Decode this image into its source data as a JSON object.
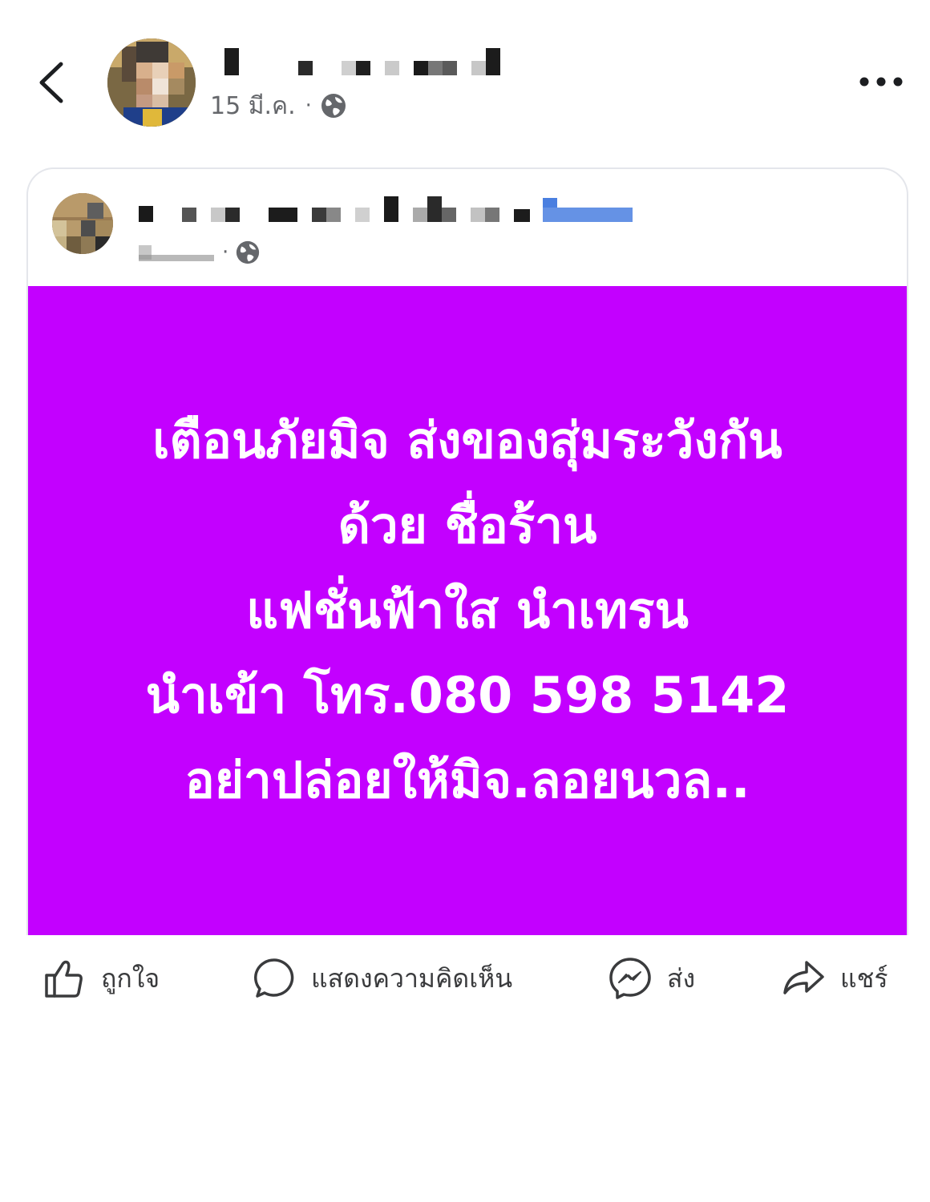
{
  "header": {
    "author_name": "",
    "date": "15 มี.ค.",
    "privacy_icon": "globe-icon",
    "back_icon": "chevron-left-icon",
    "more_icon": "more-dots-icon"
  },
  "shared_post": {
    "author_name": "",
    "date": "",
    "privacy_icon": "globe-icon",
    "banner": {
      "background": "#c300ff",
      "text_color": "#ffffff",
      "lines": [
        "เตือนภัยมิจ ส่งของสุ่มระวังกัน",
        "ด้วย ชื่อร้าน",
        "แฟชั่นฟ้าใส นำเทรน",
        "นำเข้า โทร.080 598 5142",
        "อย่าปล่อยให้มิจ.ลอยนวล.."
      ]
    }
  },
  "actions": {
    "like": "ถูกใจ",
    "comment": "แสดงความคิดเห็น",
    "send": "ส่ง",
    "share": "แชร์"
  }
}
